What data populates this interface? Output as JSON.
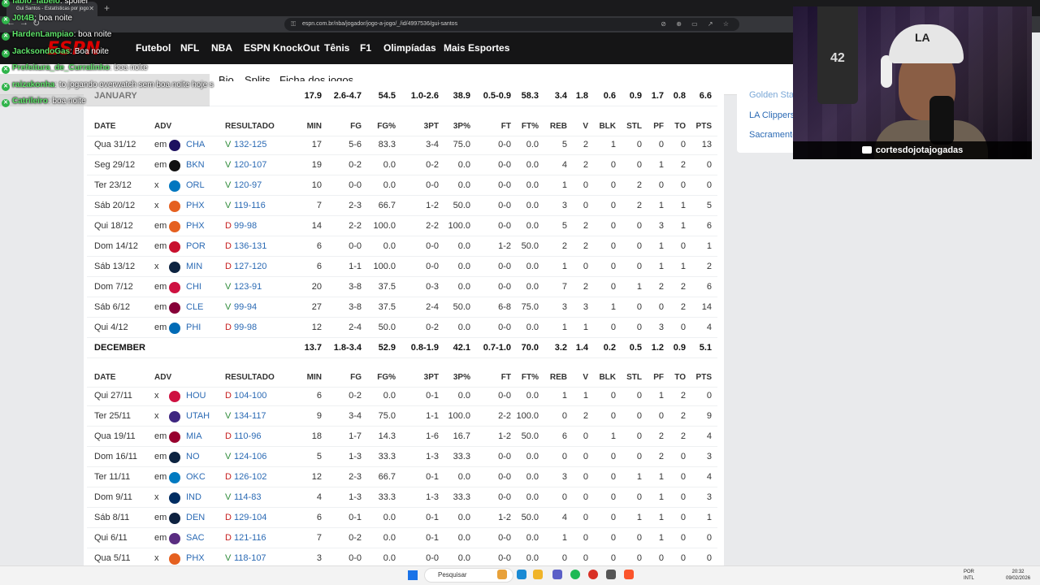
{
  "browser": {
    "tab_title": "Gui Santos - Estatísticas por jogo",
    "url": "espn.com.br/nba/jogador/jogo-a-jogo/_/id/4997536/gui-santos",
    "url_tools": "⊘ ⊕ ▭ ↗ ☆"
  },
  "nav": {
    "logo": "ESPN",
    "items": [
      "Futebol",
      "NFL",
      "NBA",
      "ESPN KnockOut",
      "Tênis",
      "F1",
      "Olimpíadas",
      "Mais Esportes"
    ]
  },
  "subnav": {
    "tabs": [
      "Bio",
      "Splits",
      "Ficha dos jogos"
    ],
    "active": "Ficha dos jogos"
  },
  "headers": [
    "DATE",
    "ADV",
    "RESULTADO",
    "MIN",
    "FG",
    "FG%",
    "3PT",
    "3P%",
    "FT",
    "FT%",
    "REB",
    "V",
    "BLK",
    "STL",
    "PF",
    "TO",
    "PTS"
  ],
  "january_summary": [
    "JANUARY",
    "17.9",
    "2.6-4.7",
    "54.5",
    "1.0-2.6",
    "38.9",
    "0.5-0.9",
    "58.3",
    "3.4",
    "1.8",
    "0.6",
    "0.9",
    "1.7",
    "0.8",
    "6.6"
  ],
  "december": {
    "rows": [
      {
        "date": "Qua 31/12",
        "loc": "em",
        "team": "CHA",
        "res": "V",
        "score": "132-125",
        "stats": [
          "17",
          "5-6",
          "83.3",
          "3-4",
          "75.0",
          "0-0",
          "0.0",
          "5",
          "2",
          "1",
          "0",
          "0",
          "0",
          "13"
        ]
      },
      {
        "date": "Seg 29/12",
        "loc": "em",
        "team": "BKN",
        "res": "V",
        "score": "120-107",
        "stats": [
          "19",
          "0-2",
          "0.0",
          "0-2",
          "0.0",
          "0-0",
          "0.0",
          "4",
          "2",
          "0",
          "0",
          "1",
          "2",
          "0"
        ]
      },
      {
        "date": "Ter 23/12",
        "loc": "x",
        "team": "ORL",
        "res": "V",
        "score": "120-97",
        "stats": [
          "10",
          "0-0",
          "0.0",
          "0-0",
          "0.0",
          "0-0",
          "0.0",
          "1",
          "0",
          "0",
          "2",
          "0",
          "0",
          "0"
        ]
      },
      {
        "date": "Sáb 20/12",
        "loc": "x",
        "team": "PHX",
        "res": "V",
        "score": "119-116",
        "stats": [
          "7",
          "2-3",
          "66.7",
          "1-2",
          "50.0",
          "0-0",
          "0.0",
          "3",
          "0",
          "0",
          "2",
          "1",
          "1",
          "5"
        ]
      },
      {
        "date": "Qui 18/12",
        "loc": "em",
        "team": "PHX",
        "res": "D",
        "score": "99-98",
        "stats": [
          "14",
          "2-2",
          "100.0",
          "2-2",
          "100.0",
          "0-0",
          "0.0",
          "5",
          "2",
          "0",
          "0",
          "3",
          "1",
          "6"
        ]
      },
      {
        "date": "Dom 14/12",
        "loc": "em",
        "team": "POR",
        "res": "D",
        "score": "136-131",
        "stats": [
          "6",
          "0-0",
          "0.0",
          "0-0",
          "0.0",
          "1-2",
          "50.0",
          "2",
          "2",
          "0",
          "0",
          "1",
          "0",
          "1"
        ]
      },
      {
        "date": "Sáb 13/12",
        "loc": "x",
        "team": "MIN",
        "res": "D",
        "score": "127-120",
        "stats": [
          "6",
          "1-1",
          "100.0",
          "0-0",
          "0.0",
          "0-0",
          "0.0",
          "1",
          "0",
          "0",
          "0",
          "1",
          "1",
          "2"
        ]
      },
      {
        "date": "Dom 7/12",
        "loc": "em",
        "team": "CHI",
        "res": "V",
        "score": "123-91",
        "stats": [
          "20",
          "3-8",
          "37.5",
          "0-3",
          "0.0",
          "0-0",
          "0.0",
          "7",
          "2",
          "0",
          "1",
          "2",
          "2",
          "6"
        ]
      },
      {
        "date": "Sáb 6/12",
        "loc": "em",
        "team": "CLE",
        "res": "V",
        "score": "99-94",
        "stats": [
          "27",
          "3-8",
          "37.5",
          "2-4",
          "50.0",
          "6-8",
          "75.0",
          "3",
          "3",
          "1",
          "0",
          "0",
          "2",
          "14"
        ]
      },
      {
        "date": "Qui 4/12",
        "loc": "em",
        "team": "PHI",
        "res": "D",
        "score": "99-98",
        "stats": [
          "12",
          "2-4",
          "50.0",
          "0-2",
          "0.0",
          "0-0",
          "0.0",
          "1",
          "1",
          "0",
          "0",
          "3",
          "0",
          "4"
        ]
      }
    ],
    "summary": [
      "DECEMBER",
      "13.7",
      "1.8-3.4",
      "52.9",
      "0.8-1.9",
      "42.1",
      "0.7-1.0",
      "70.0",
      "3.2",
      "1.4",
      "0.2",
      "0.5",
      "1.2",
      "0.9",
      "5.1"
    ]
  },
  "november": {
    "rows": [
      {
        "date": "Qui 27/11",
        "loc": "x",
        "team": "HOU",
        "res": "D",
        "score": "104-100",
        "stats": [
          "6",
          "0-2",
          "0.0",
          "0-1",
          "0.0",
          "0-0",
          "0.0",
          "1",
          "1",
          "0",
          "0",
          "1",
          "2",
          "0"
        ]
      },
      {
        "date": "Ter 25/11",
        "loc": "x",
        "team": "UTAH",
        "res": "V",
        "score": "134-117",
        "stats": [
          "9",
          "3-4",
          "75.0",
          "1-1",
          "100.0",
          "2-2",
          "100.0",
          "0",
          "2",
          "0",
          "0",
          "0",
          "2",
          "9"
        ]
      },
      {
        "date": "Qua 19/11",
        "loc": "em",
        "team": "MIA",
        "res": "D",
        "score": "110-96",
        "stats": [
          "18",
          "1-7",
          "14.3",
          "1-6",
          "16.7",
          "1-2",
          "50.0",
          "6",
          "0",
          "1",
          "0",
          "2",
          "2",
          "4"
        ]
      },
      {
        "date": "Dom 16/11",
        "loc": "em",
        "team": "NO",
        "res": "V",
        "score": "124-106",
        "stats": [
          "5",
          "1-3",
          "33.3",
          "1-3",
          "33.3",
          "0-0",
          "0.0",
          "0",
          "0",
          "0",
          "0",
          "2",
          "0",
          "3"
        ]
      },
      {
        "date": "Ter 11/11",
        "loc": "em",
        "team": "OKC",
        "res": "D",
        "score": "126-102",
        "stats": [
          "12",
          "2-3",
          "66.7",
          "0-1",
          "0.0",
          "0-0",
          "0.0",
          "3",
          "0",
          "0",
          "1",
          "1",
          "0",
          "4"
        ]
      },
      {
        "date": "Dom 9/11",
        "loc": "x",
        "team": "IND",
        "res": "V",
        "score": "114-83",
        "stats": [
          "4",
          "1-3",
          "33.3",
          "1-3",
          "33.3",
          "0-0",
          "0.0",
          "0",
          "0",
          "0",
          "0",
          "1",
          "0",
          "3"
        ]
      },
      {
        "date": "Sáb 8/11",
        "loc": "em",
        "team": "DEN",
        "res": "D",
        "score": "129-104",
        "stats": [
          "6",
          "0-1",
          "0.0",
          "0-1",
          "0.0",
          "1-2",
          "50.0",
          "4",
          "0",
          "0",
          "1",
          "1",
          "0",
          "1"
        ]
      },
      {
        "date": "Qui 6/11",
        "loc": "em",
        "team": "SAC",
        "res": "D",
        "score": "121-116",
        "stats": [
          "7",
          "0-2",
          "0.0",
          "0-1",
          "0.0",
          "0-0",
          "0.0",
          "1",
          "0",
          "0",
          "0",
          "1",
          "0",
          "0"
        ]
      },
      {
        "date": "Qua 5/11",
        "loc": "x",
        "team": "PHX",
        "res": "V",
        "score": "118-107",
        "stats": [
          "3",
          "0-0",
          "0.0",
          "0-0",
          "0.0",
          "0-0",
          "0.0",
          "0",
          "0",
          "0",
          "0",
          "0",
          "0",
          "0"
        ]
      }
    ]
  },
  "team_colors": {
    "CHA": "#1d1160",
    "BKN": "#111111",
    "ORL": "#0077c0",
    "PHX": "#e56020",
    "POR": "#c8102e",
    "MIN": "#0c2340",
    "CHI": "#ce1141",
    "CLE": "#860038",
    "PHI": "#006bb6",
    "HOU": "#ce1141",
    "UTAH": "#3e2680",
    "MIA": "#98002e",
    "NO": "#0c2340",
    "OKC": "#007ac1",
    "IND": "#002d62",
    "DEN": "#0e2240",
    "SAC": "#5a2d81"
  },
  "sidebar": {
    "items": [
      "Golden State",
      "LA Clippers",
      "Sacramento"
    ]
  },
  "webcam": {
    "cap_logo": "LA",
    "jersey_number": "42",
    "channel": "cortesdojotajogadas"
  },
  "chat": [
    {
      "name": "fabio_fabelo",
      "msg": "spoiler"
    },
    {
      "name": "J0t4B",
      "msg": "boa noite"
    },
    {
      "name": "HardenLampiao",
      "msg": "boa noite"
    },
    {
      "name": "JacksondoGas",
      "msg": "Boa noite"
    },
    {
      "name": "Prefeitura_de_Curralinho",
      "msg": "boa noite"
    },
    {
      "name": "raizakonha",
      "msg": "to jogando overwatch sem boa noite hoje s"
    },
    {
      "name": "Catrileiro",
      "msg": "boa noite"
    }
  ],
  "taskbar": {
    "search": "Pesquisar",
    "lang": "POR\nINTL",
    "time": "20:32",
    "date": "09/02/2026"
  }
}
